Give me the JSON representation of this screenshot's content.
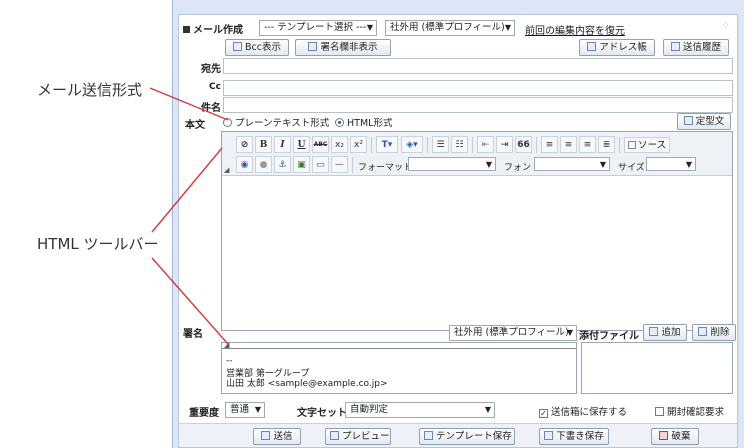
{
  "callouts": {
    "mail_format": "メール送信形式",
    "html_toolbar": "HTML ツールバー"
  },
  "header": {
    "title": "メール作成",
    "template_select": "--- テンプレート選択 ---",
    "profile_select": "社外用 (標準プロフィール)",
    "restore_link": "前回の編集内容を復元"
  },
  "toolbar": {
    "bcc_button": "Bcc表示",
    "sig_field_hide_button": "署名欄非表示",
    "address_book_button": "アドレス帳",
    "history_button": "送信履歴"
  },
  "fields": {
    "to": "宛先",
    "cc": "Cc",
    "subject": "件名"
  },
  "body": {
    "label": "本文",
    "plain_text_option": "プレーンテキスト形式",
    "html_option": "HTML形式",
    "template_text_button": "定型文"
  },
  "editor": {
    "source_button": "ソース",
    "format_label": "フォーマット",
    "font_label": "フォント",
    "size_label": "サイズ",
    "buttons": [
      "B",
      "I",
      "U",
      "ABC",
      "x₂",
      "x²",
      "66"
    ]
  },
  "signature": {
    "label": "署名",
    "profile_select": "社外用 (標準プロフィール)",
    "lines": [
      "--",
      "営業部 第一グループ",
      "山田 太郎 <sample@example.co.jp>"
    ]
  },
  "attachments": {
    "label": "添付ファイル",
    "add_button": "追加",
    "delete_button": "削除"
  },
  "options": {
    "priority_label": "重要度",
    "priority_value": "普通",
    "charset_label": "文字セット",
    "charset_value": "自動判定",
    "save_sent_label": "送信箱に保存する",
    "save_sent_checked": true,
    "read_receipt_label": "開封確認要求",
    "read_receipt_checked": false
  },
  "actions": {
    "send": "送信",
    "preview": "プレビュー",
    "save_template": "テンプレート保存",
    "save_draft": "下書き保存",
    "discard": "破棄"
  }
}
